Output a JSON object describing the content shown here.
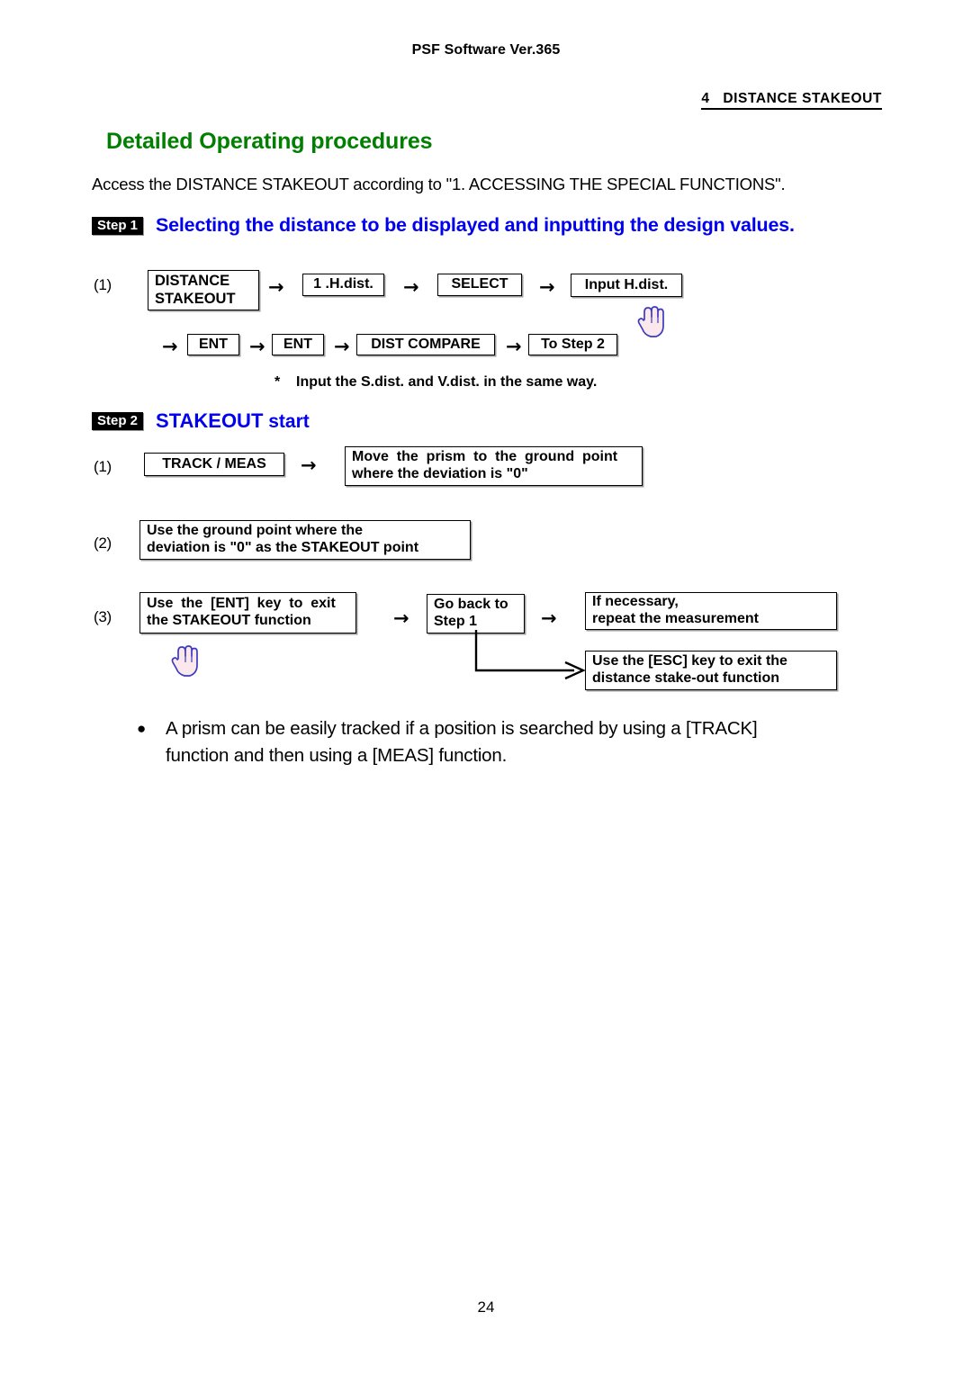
{
  "header": {
    "software": "PSF Software Ver.365",
    "section": "4   DISTANCE STAKEOUT"
  },
  "title": "Detailed Operating procedures",
  "intro": "Access the DISTANCE STAKEOUT according to \"1. ACCESSING THE SPECIAL FUNCTIONS\".",
  "steps": [
    {
      "badge": "Step 1",
      "title": "Selecting the distance to be displayed and inputting the design values.",
      "index_1": "(1)",
      "flow_row1": [
        "DISTANCE\nSTAKEOUT",
        "1 .H.dist.",
        "SELECT",
        "Input H.dist."
      ],
      "flow_row2": [
        "ENT",
        "ENT",
        "DIST COMPARE",
        "To Step 2"
      ],
      "note": "*    Input the S.dist. and V.dist. in the same way."
    },
    {
      "badge": "Step 2",
      "title_main": "STAKEOUT",
      "title_sub": " start",
      "index_1": "(1)",
      "index_2": "(2)",
      "index_3": "(3)",
      "box_track_meas": "TRACK / MEAS",
      "box_move_prism": "Move  the  prism  to  the  ground  point\nwhere the deviation is \"0\"",
      "box_use_ground": "Use the ground point where the\ndeviation is \"0\" as the STAKEOUT point",
      "box_use_ent": "Use  the  [ENT]  key  to  exit\nthe STAKEOUT function",
      "box_go_back": "Go back to\nStep 1",
      "box_if_necessary": "If necessary,\nrepeat the measurement",
      "box_use_esc": "Use the [ESC] key to exit the\ndistance stake-out function"
    }
  ],
  "arrow_glyph": "→",
  "bullet": {
    "dot": "●",
    "text": "A prism can be easily tracked if a position is searched by using a [TRACK]\nfunction and then using a [MEAS] function."
  },
  "page_number": "24",
  "colors": {
    "title_green": "#007f00",
    "heading_blue": "#0000ee",
    "badge_bg": "#000000",
    "hand_outline": "#3b3bbf",
    "hand_fill": "#fbe8ec"
  }
}
